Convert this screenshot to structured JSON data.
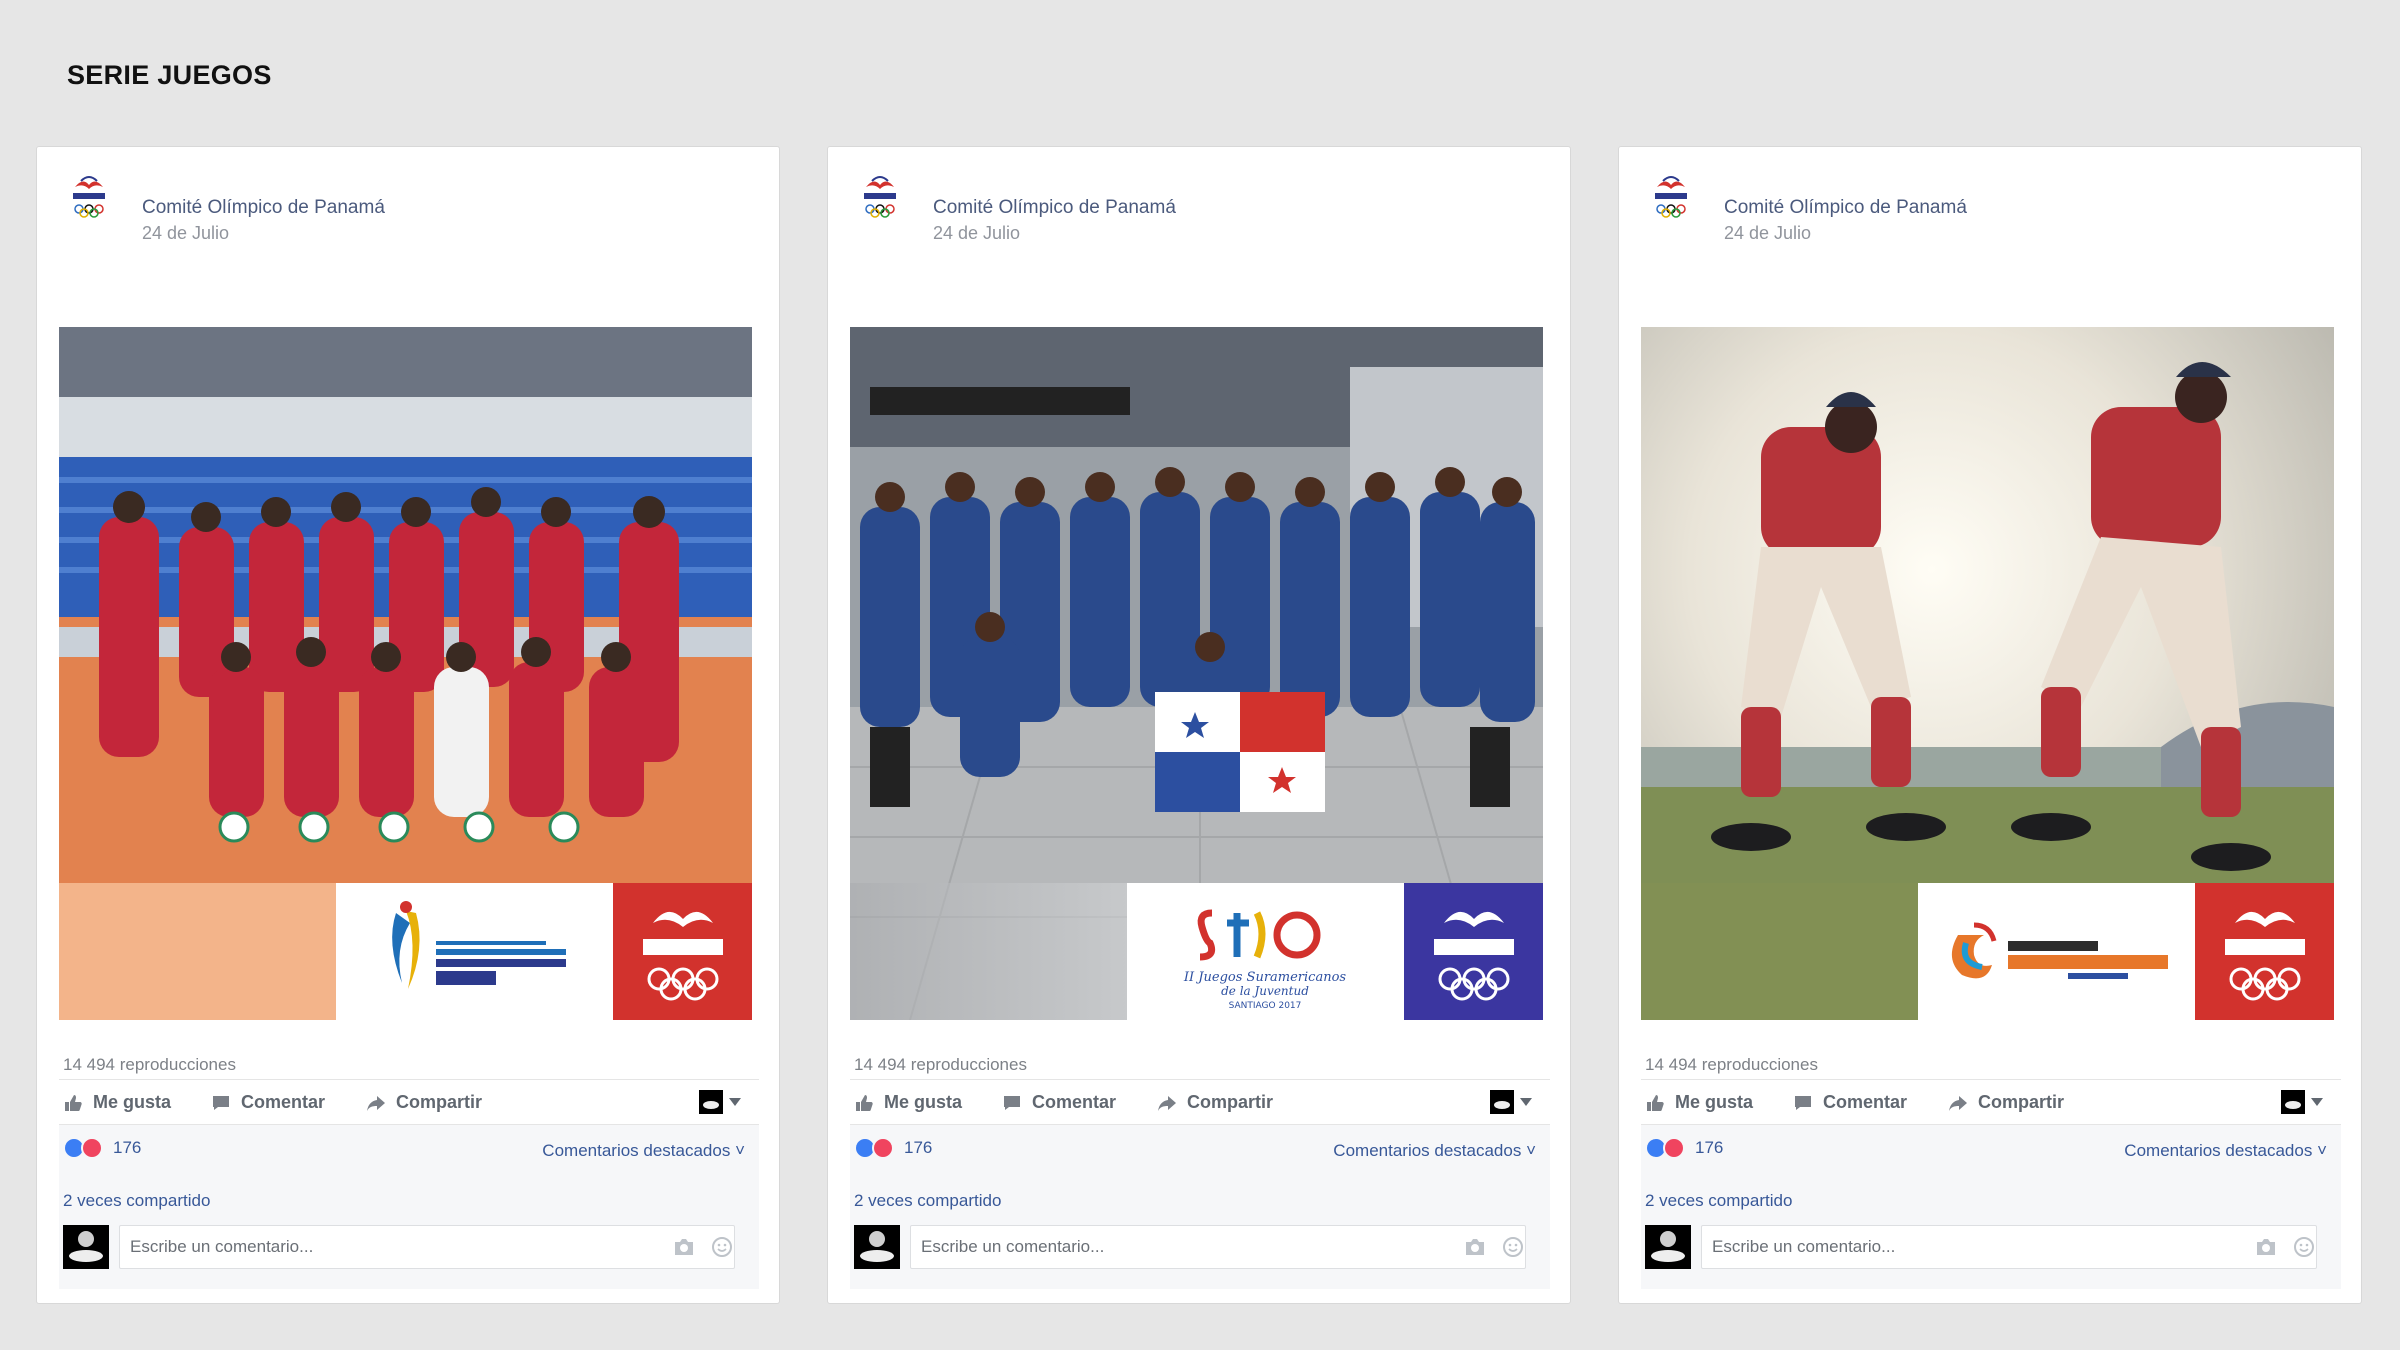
{
  "page": {
    "title": "SERIE JUEGOS"
  },
  "posts": [
    {
      "page_name": "Comité Olímpico de Panamá",
      "date": "24 de Julio",
      "image": {
        "subject": "volleyball-team-photo",
        "event_logo": "managua-2017-logo",
        "accent_color": "#d2322d",
        "corner_color": "#f3b48a"
      },
      "views": "14 494 reproducciones",
      "actions": {
        "like": "Me gusta",
        "comment": "Comentar",
        "share": "Compartir"
      },
      "reactions_count": "176",
      "top_comments": "Comentarios destacados ˅",
      "shares": "2 veces compartido",
      "comment_placeholder": "Escribe un comentario..."
    },
    {
      "page_name": "Comité Olímpico de Panamá",
      "date": "24 de Julio",
      "image": {
        "subject": "youth-team-airport-photo",
        "event_logo": "santiago-2017-logo",
        "accent_color": "#3b36a0",
        "corner_color": "#ffffff"
      },
      "views": "14 494 reproducciones",
      "actions": {
        "like": "Me gusta",
        "comment": "Comentar",
        "share": "Compartir"
      },
      "reactions_count": "176",
      "top_comments": "Comentarios destacados ˅",
      "shares": "2 veces compartido",
      "comment_placeholder": "Escribe un comentario..."
    },
    {
      "page_name": "Comité Olímpico de Panamá",
      "date": "24 de Julio",
      "image": {
        "subject": "softball-players-photo",
        "event_logo": "bolivarianos-2017-logo",
        "accent_color": "#d2322d",
        "corner_color": "#ffffff"
      },
      "views": "14 494 reproducciones",
      "actions": {
        "like": "Me gusta",
        "comment": "Comentar",
        "share": "Compartir"
      },
      "reactions_count": "176",
      "top_comments": "Comentarios destacados ˅",
      "shares": "2 veces compartido",
      "comment_placeholder": "Escribe un comentario..."
    }
  ]
}
